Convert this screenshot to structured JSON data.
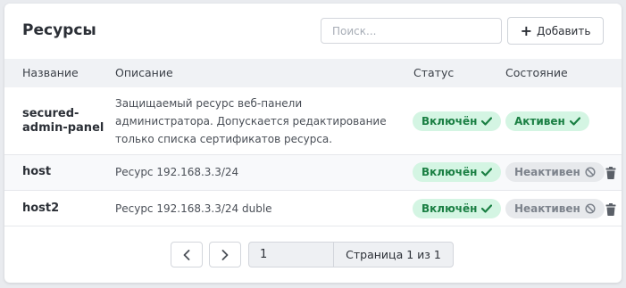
{
  "header": {
    "title": "Ресурсы",
    "search_placeholder": "Поиск...",
    "add_label": "Добавить"
  },
  "table": {
    "columns": [
      "Название",
      "Описание",
      "Статус",
      "Состояние"
    ],
    "rows": [
      {
        "name": "secured-admin-panel",
        "name_lines": [
          "secured-",
          "admin-panel"
        ],
        "description_lines": [
          "Защищаемый ресурс веб-панели",
          "администратора. Допускается редактирование",
          "только списка сертификатов ресурса."
        ],
        "status": "Включён",
        "state": "Активен",
        "state_active": true,
        "deletable": false
      },
      {
        "name": "host",
        "description_lines": [
          "Ресурс 192.168.3.3/24"
        ],
        "status": "Включён",
        "state": "Неактивен",
        "state_active": false,
        "deletable": true
      },
      {
        "name": "host2",
        "description_lines": [
          "Ресурс 192.168.3.3/24 duble"
        ],
        "status": "Включён",
        "state": "Неактивен",
        "state_active": false,
        "deletable": true
      }
    ]
  },
  "pagination": {
    "page_value": "1",
    "page_label": "Страница 1 из 1"
  },
  "colors": {
    "badge_on_bg": "#d4f5e3",
    "badge_on_text": "#1a7f43",
    "badge_off_bg": "#e7e9ec",
    "badge_off_text": "#7d838c"
  },
  "icons": {
    "add": "plus-icon",
    "enabled": "check-icon",
    "inactive": "ban-icon",
    "delete": "trash-icon",
    "prev": "chevron-left-icon",
    "next": "chevron-right-icon"
  }
}
